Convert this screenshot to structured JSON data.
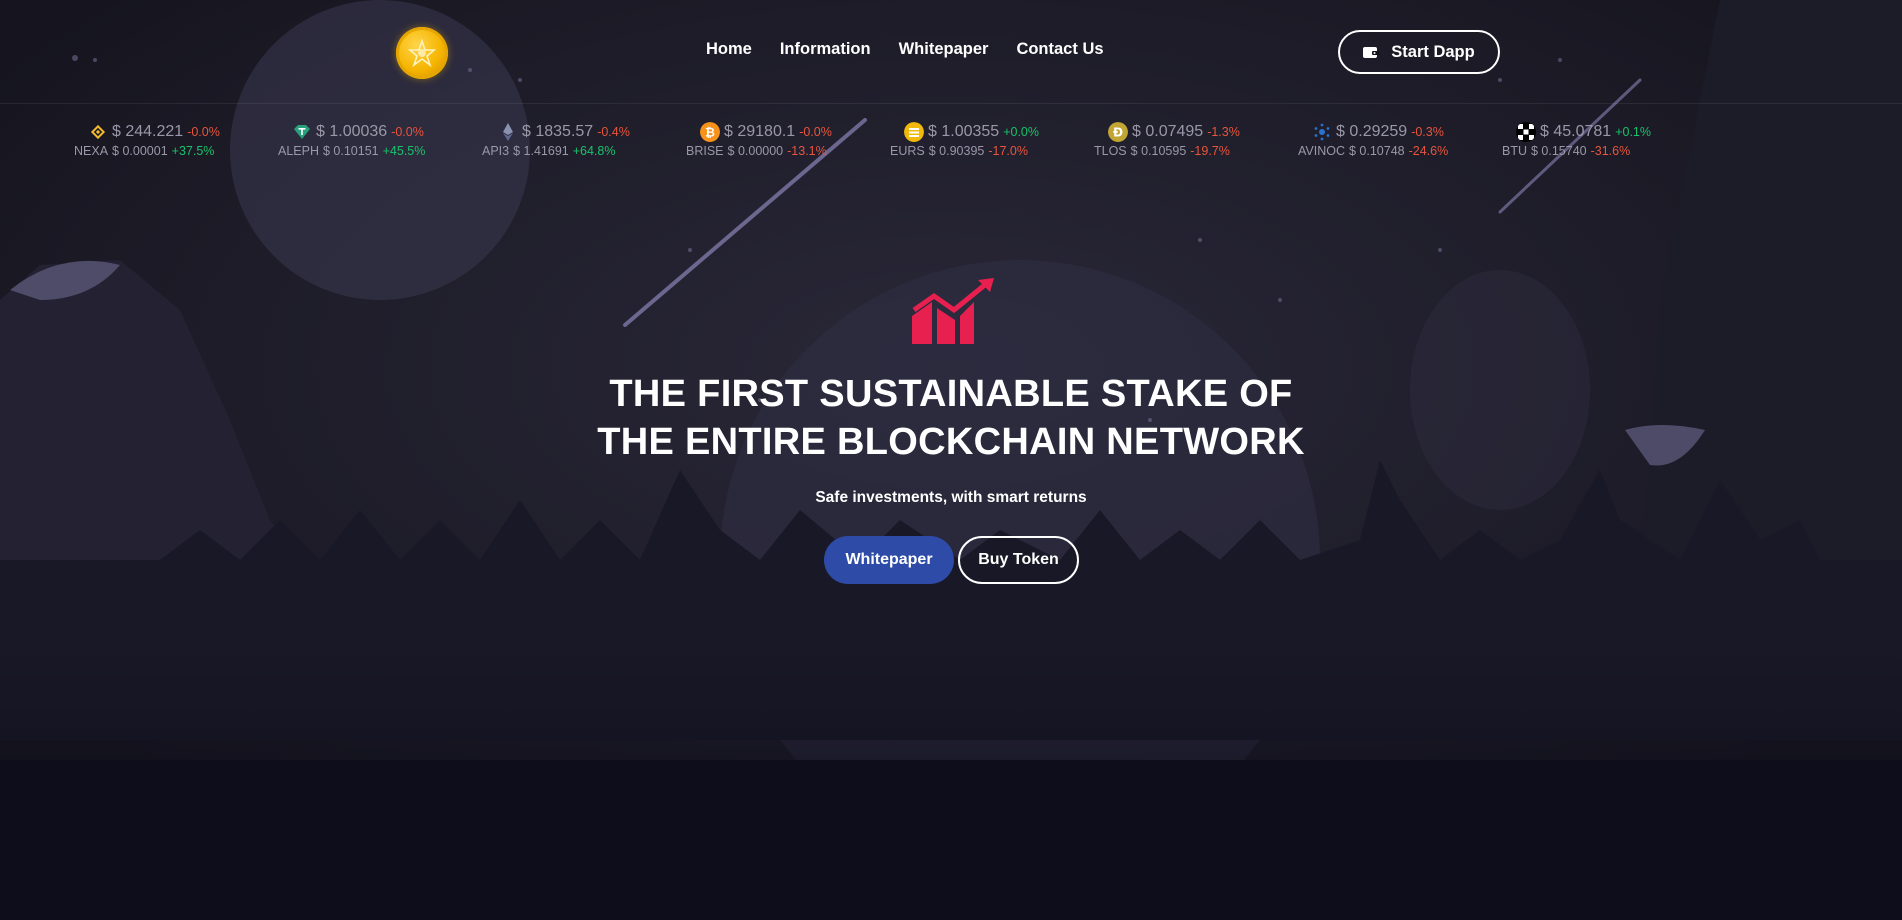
{
  "header": {
    "logo_icon": "gold-coin-logo-icon",
    "nav": [
      {
        "label": "Home"
      },
      {
        "label": "Information"
      },
      {
        "label": "Whitepaper"
      },
      {
        "label": "Contact Us"
      }
    ],
    "start_button": {
      "label": "Start Dapp",
      "icon": "wallet-icon"
    }
  },
  "ticker": [
    {
      "icon": "bnb-icon",
      "color": "#f3ba2f",
      "price": "$ 244.221",
      "change": "-0.0%",
      "change_dir": "neg",
      "symbol": "NEXA",
      "symbol_price": "$ 0.00001",
      "symbol_change": "+37.5%",
      "symbol_change_dir": "pos"
    },
    {
      "icon": "tether-icon",
      "color": "#26a17b",
      "price": "$ 1.00036",
      "change": "-0.0%",
      "change_dir": "neg",
      "symbol": "ALEPH",
      "symbol_price": "$ 0.10151",
      "symbol_change": "+45.5%",
      "symbol_change_dir": "pos"
    },
    {
      "icon": "ethereum-icon",
      "color": "#8a92b2",
      "price": "$ 1835.57",
      "change": "-0.4%",
      "change_dir": "neg",
      "symbol": "API3",
      "symbol_price": "$ 1.41691",
      "symbol_change": "+64.8%",
      "symbol_change_dir": "pos"
    },
    {
      "icon": "bitcoin-icon",
      "color": "#f7931a",
      "price": "$ 29180.1",
      "change": "-0.0%",
      "change_dir": "neg",
      "symbol": "BRISE",
      "symbol_price": "$ 0.00000",
      "symbol_change": "-13.1%",
      "symbol_change_dir": "neg"
    },
    {
      "icon": "busd-icon",
      "color": "#f0b90b",
      "price": "$ 1.00355",
      "change": "+0.0%",
      "change_dir": "pos",
      "symbol": "EURS",
      "symbol_price": "$ 0.90395",
      "symbol_change": "-17.0%",
      "symbol_change_dir": "neg"
    },
    {
      "icon": "dogecoin-icon",
      "color": "#c2a633",
      "price": "$ 0.07495",
      "change": "-1.3%",
      "change_dir": "neg",
      "symbol": "TLOS",
      "symbol_price": "$ 0.10595",
      "symbol_change": "-19.7%",
      "symbol_change_dir": "neg"
    },
    {
      "icon": "cardano-icon",
      "color": "#2a71d0",
      "price": "$ 0.29259",
      "change": "-0.3%",
      "change_dir": "neg",
      "symbol": "AVINOC",
      "symbol_price": "$ 0.10748",
      "symbol_change": "-24.6%",
      "symbol_change_dir": "neg"
    },
    {
      "icon": "okb-icon",
      "color": "#ffffff",
      "price": "$ 45.0781",
      "change": "+0.1%",
      "change_dir": "pos",
      "symbol": "BTU",
      "symbol_price": "$ 0.15740",
      "symbol_change": "-31.6%",
      "symbol_change_dir": "neg"
    }
  ],
  "hero": {
    "icon": "growth-chart-icon",
    "title_line1": "THE FIRST SUSTAINABLE STAKE OF",
    "title_line2": "THE ENTIRE BLOCKCHAIN NETWORK",
    "subtitle": "Safe investments, with smart returns",
    "primary_button": "Whitepaper",
    "secondary_button": "Buy Token"
  },
  "colors": {
    "background": "#12111c",
    "accent_red": "#e8204f",
    "primary_blue": "#2e4ba8",
    "positive": "#19c26a",
    "negative": "#e8553d"
  }
}
